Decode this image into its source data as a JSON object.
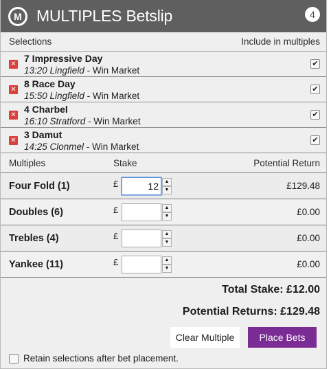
{
  "header": {
    "logo_letter": "M",
    "title": "MULTIPLES Betslip",
    "count": "4"
  },
  "selections_header": {
    "left": "Selections",
    "right": "Include in multiples"
  },
  "selections": [
    {
      "name": "7 Impressive Day",
      "time_course": "13:20 Lingfield",
      "market": " - Win Market",
      "included": true
    },
    {
      "name": "8 Race Day",
      "time_course": "15:50 Lingfield",
      "market": " - Win Market",
      "included": true
    },
    {
      "name": "4 Charbel",
      "time_course": "16:10 Stratford",
      "market": " - Win Market",
      "included": true
    },
    {
      "name": "3 Damut",
      "time_course": "14:25 Clonmel",
      "market": " - Win Market",
      "included": true
    }
  ],
  "multiples_header": {
    "col1": "Multiples",
    "col2": "Stake",
    "col3": "Potential Return"
  },
  "multiples": [
    {
      "label": "Four Fold (1)",
      "currency": "£",
      "stake": "12",
      "return": "£129.48"
    },
    {
      "label": "Doubles (6)",
      "currency": "£",
      "stake": "",
      "return": "£0.00"
    },
    {
      "label": "Trebles (4)",
      "currency": "£",
      "stake": "",
      "return": "£0.00"
    },
    {
      "label": "Yankee (11)",
      "currency": "£",
      "stake": "",
      "return": "£0.00"
    }
  ],
  "totals": {
    "total_stake": "Total Stake: £12.00",
    "potential_returns": "Potential Returns: £129.48"
  },
  "actions": {
    "clear_label": "Clear Multiple",
    "place_label": "Place Bets"
  },
  "retain": {
    "label": "Retain selections after bet placement.",
    "checked": false
  },
  "icons": {
    "remove": "remove-x-icon",
    "check": "checkmark-icon",
    "spin_up": "arrow-up-icon",
    "spin_down": "arrow-down-icon"
  },
  "colors": {
    "header_bg": "#5f5f5f",
    "remove_red": "#d9413a",
    "place_purple": "#7b2b94",
    "panel_bg": "#efefef"
  }
}
